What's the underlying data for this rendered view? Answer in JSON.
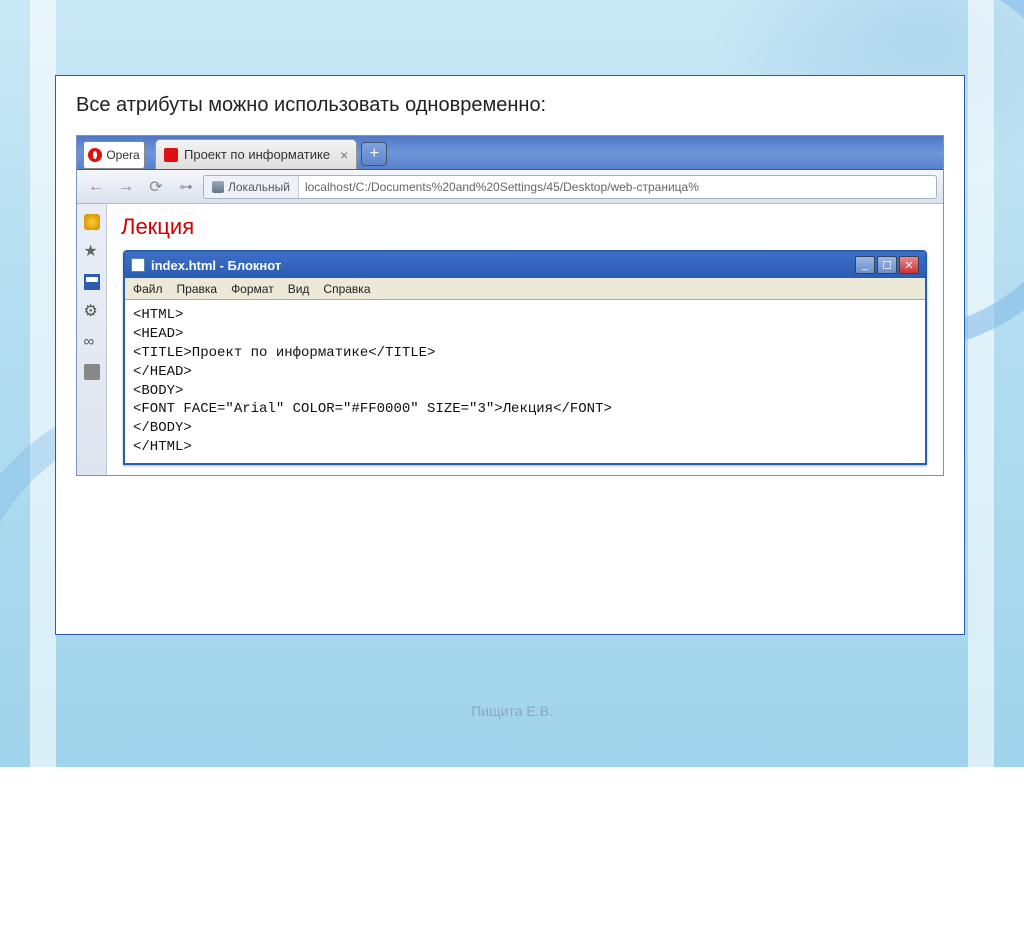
{
  "slide": {
    "title": "Все атрибуты можно использовать одновременно:"
  },
  "browser": {
    "opera_label": "Opera",
    "tab_title": "Проект по информатике",
    "address_badge": "Локальный",
    "address_url": "localhost/C:/Documents%20and%20Settings/45/Desktop/web-страница%"
  },
  "page": {
    "heading": "Лекция"
  },
  "notepad": {
    "title": "index.html - Блокнот",
    "menu": {
      "file": "Файл",
      "edit": "Правка",
      "format": "Формат",
      "view": "Вид",
      "help": "Справка"
    },
    "body": "<HTML>\n<HEAD>\n<TITLE>Проект по информатике</TITLE>\n</HEAD>\n<BODY>\n<FONT FACE=\"Arial\" COLOR=\"#FF0000\" SIZE=\"3\">Лекция</FONT>\n</BODY>\n</HTML>"
  },
  "footer": {
    "credit": "Пищита Е.В."
  }
}
